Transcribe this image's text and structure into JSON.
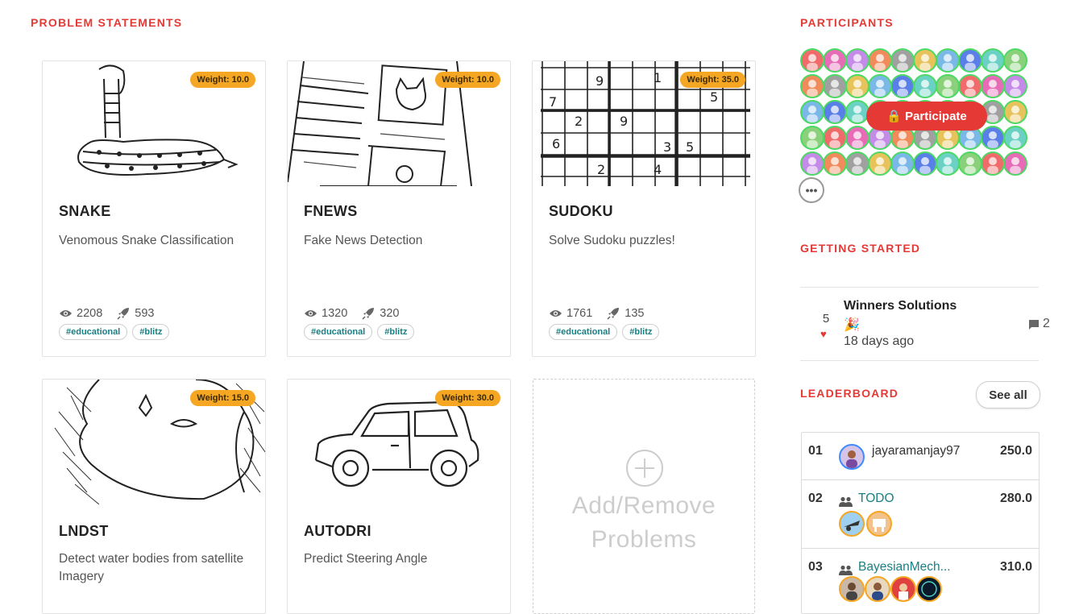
{
  "sections": {
    "problems": "PROBLEM STATEMENTS",
    "participants": "PARTICIPANTS",
    "getting_started": "GETTING STARTED",
    "leaderboard": "LEADERBOARD"
  },
  "problems": [
    {
      "title": "SNAKE",
      "desc": "Venomous Snake Classification",
      "views": "2208",
      "subs": "593",
      "weight": "Weight: 10.0",
      "tags": [
        "#educational",
        "#blitz"
      ]
    },
    {
      "title": "FNEWS",
      "desc": "Fake News Detection",
      "views": "1320",
      "subs": "320",
      "weight": "Weight: 10.0",
      "tags": [
        "#educational",
        "#blitz"
      ]
    },
    {
      "title": "SUDOKU",
      "desc": "Solve Sudoku puzzles!",
      "views": "1761",
      "subs": "135",
      "weight": "Weight: 35.0",
      "tags": [
        "#educational",
        "#blitz"
      ]
    },
    {
      "title": "LNDST",
      "desc": "Detect water bodies from satellite Imagery",
      "weight": "Weight: 15.0"
    },
    {
      "title": "AUTODRI",
      "desc": "Predict Steering Angle",
      "weight": "Weight: 30.0"
    }
  ],
  "add_problems": "Add/Remove Problems",
  "participate_label": "🔒 Participate",
  "more_label": "•••",
  "getting_started": {
    "votes": "5",
    "title": "Winners Solutions",
    "emoji": "🎉",
    "time": "18 days ago",
    "comments": "2"
  },
  "leaderboard": {
    "see_all": "See all",
    "rows": [
      {
        "rank": "01",
        "name": "jayaramanjay97",
        "score": "250.0"
      },
      {
        "rank": "02",
        "name": "TODO",
        "score": "280.0"
      },
      {
        "rank": "03",
        "name": "BayesianMech...",
        "score": "310.0"
      }
    ]
  },
  "colors": {
    "accent": "#e53935",
    "badge": "#f5a623",
    "tag": "#1a7f83",
    "online": "#4cd964"
  }
}
